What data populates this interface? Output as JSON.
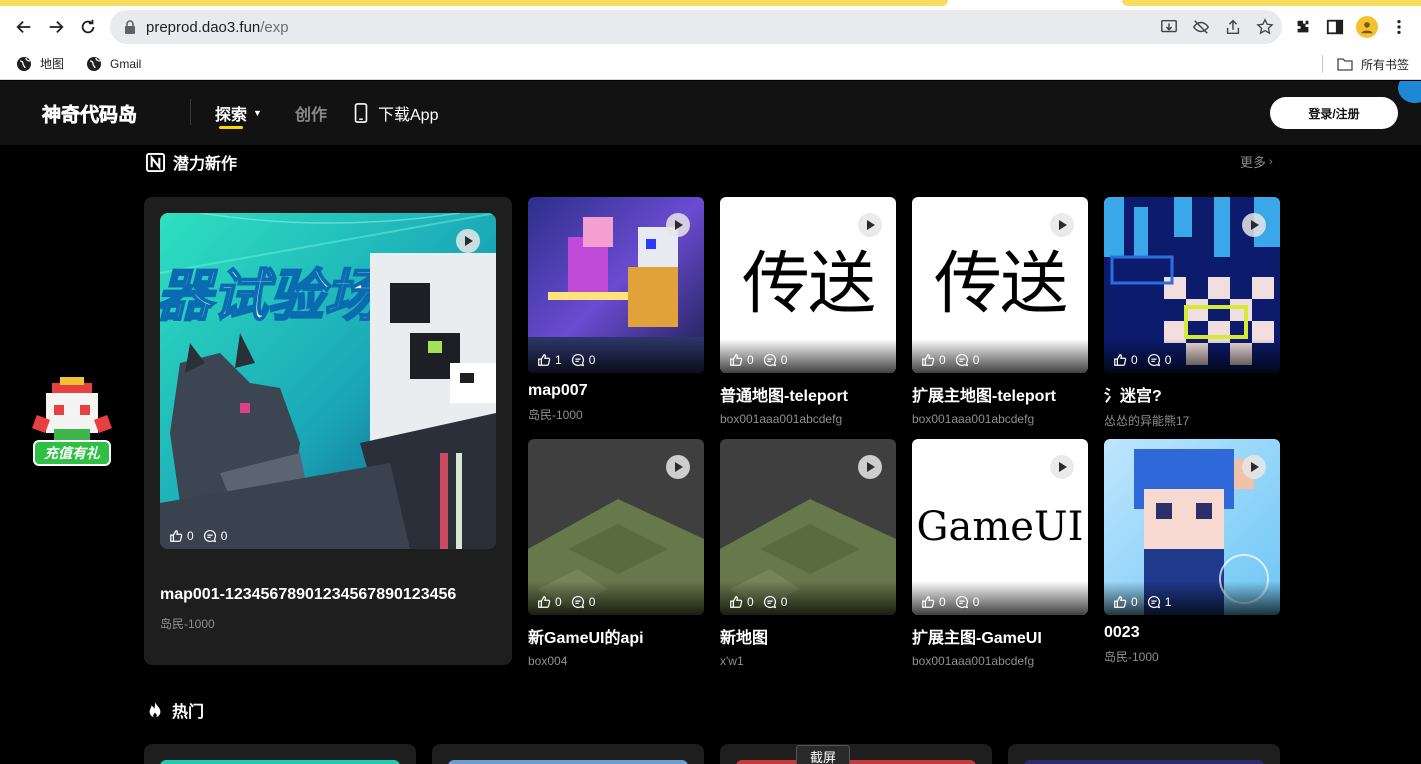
{
  "browser": {
    "url_host": "preprod.dao3.fun",
    "url_path": "/exp",
    "bookmarks": [
      {
        "label": "地图"
      },
      {
        "label": "Gmail"
      }
    ],
    "all_bookmarks": "所有书签"
  },
  "site": {
    "logo": "神奇代码岛",
    "nav": {
      "explore": "探索",
      "create": "创作",
      "download": "下载App"
    },
    "login": "登录/注册",
    "gift_label": "充值有礼",
    "section_new": {
      "title": "潜力新作",
      "more": "更多"
    },
    "featured": {
      "banner_text": "器试验场",
      "title": "map001-12345678901234567890123456",
      "author": "岛民-1000",
      "likes": "0",
      "comments": "0"
    },
    "cards": [
      {
        "title": "map007",
        "author": "岛民-1000",
        "likes": "1",
        "comments": "0"
      },
      {
        "title": "普通地图-teleport",
        "author": "box001aaa001abcdefg",
        "likes": "0",
        "comments": "0",
        "thumb_text": "传送"
      },
      {
        "title": "扩展主地图-teleport",
        "author": "box001aaa001abcdefg",
        "likes": "0",
        "comments": "0",
        "thumb_text": "传送"
      },
      {
        "title": "氵迷宫?",
        "author": "怂怂的异能熊17",
        "likes": "0",
        "comments": "0"
      },
      {
        "title": "新GameUI的api",
        "author": "box004",
        "likes": "0",
        "comments": "0"
      },
      {
        "title": "新地图",
        "author": "x'w1",
        "likes": "0",
        "comments": "0"
      },
      {
        "title": "扩展主图-GameUI",
        "author": "box001aaa001abcdefg",
        "likes": "0",
        "comments": "0",
        "thumb_text": "GameUI"
      },
      {
        "title": "0023",
        "author": "岛民-1000",
        "likes": "0",
        "comments": "1"
      }
    ],
    "section_hot": {
      "title": "热门"
    },
    "screenshot_tip": "截屏"
  }
}
